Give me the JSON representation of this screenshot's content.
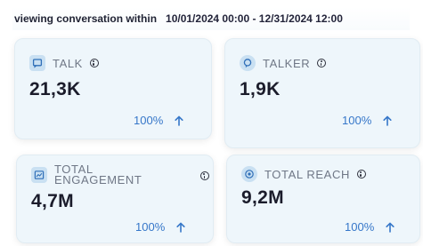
{
  "header": {
    "label": "viewing conversation within",
    "range": "10/01/2024 00:00 - 12/31/2024 12:00"
  },
  "cards": [
    {
      "title": "TALK",
      "icon": "chat-square-icon",
      "value": "21,3K",
      "change": "100%",
      "trend": "up"
    },
    {
      "title": "TALKER",
      "icon": "person-bubble-icon",
      "value": "1,9K",
      "change": "100%",
      "trend": "up"
    },
    {
      "title": "TOTAL ENGAGEMENT",
      "icon": "engagement-chart-icon",
      "value": "4,7M",
      "change": "100%",
      "trend": "up"
    },
    {
      "title": "TOTAL REACH",
      "icon": "reach-target-icon",
      "value": "9,2M",
      "change": "100%",
      "trend": "up"
    }
  ],
  "colors": {
    "card_bg": "#eef6fb",
    "accent": "#3677c9",
    "icon_bg": "#c9e0f2"
  }
}
